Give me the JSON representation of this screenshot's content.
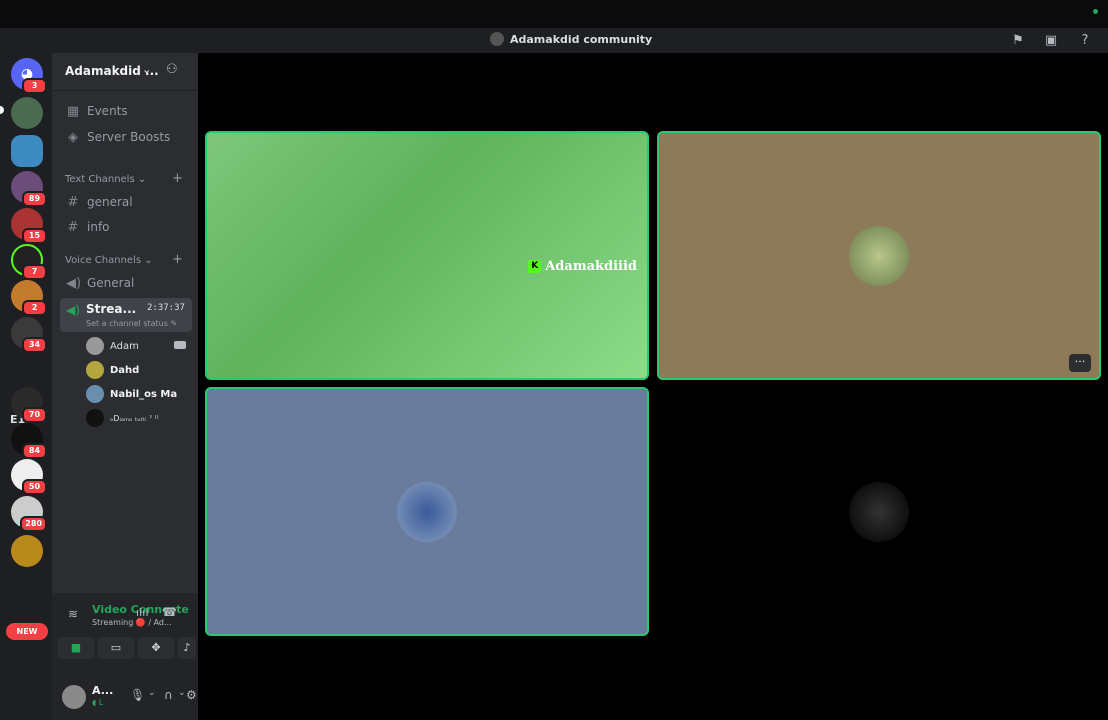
{
  "window": {
    "title": "Adamakdid community"
  },
  "rail": {
    "servers": [
      {
        "badge": "3",
        "color": "#5865f2"
      },
      {
        "badge": "",
        "color": "#4a6b4f"
      },
      {
        "badge": "",
        "color": "#3d8ac0"
      },
      {
        "badge": "89",
        "color": "#6b4c7a"
      },
      {
        "badge": "15",
        "color": "#a33"
      },
      {
        "badge": "7",
        "color": "#222"
      },
      {
        "badge": "2",
        "color": "#c27a2c"
      },
      {
        "badge": "34",
        "color": "#3a3a3a"
      },
      {
        "badge": "70",
        "color": "#2a2a2a"
      },
      {
        "badge": "84",
        "color": "#111"
      },
      {
        "badge": "50",
        "color": "#eee"
      },
      {
        "badge": "280",
        "color": "#ccc"
      },
      {
        "badge": "",
        "color": "#b88a1c"
      }
    ],
    "text_server": "E1F",
    "new_label": "NEW"
  },
  "sidebar": {
    "server_name": "Adamakdid ...",
    "events": "Events",
    "boosts": "Server Boosts",
    "text_category": "Text Channels",
    "text_channels": [
      "general",
      "info"
    ],
    "voice_category": "Voice Channels",
    "voice_general": "General",
    "stream_channel": "Strea...",
    "stream_time": "2:37:37",
    "stream_status": "Set a channel status",
    "members": [
      "Adam",
      "Dahd",
      "Nabil_os Ma",
      "ₒDᵢₐₘₒ ₜᵤₜₜᵢ ˀ ⁽⁾"
    ]
  },
  "voice_panel": {
    "title": "Video Connecte",
    "subtitle": "Streaming 🔴 / Ad...",
    "user_name": "A...",
    "user_status": "◖ L"
  },
  "stage": {
    "streamer_label": "Adamakdiiid",
    "more_label": "···"
  }
}
